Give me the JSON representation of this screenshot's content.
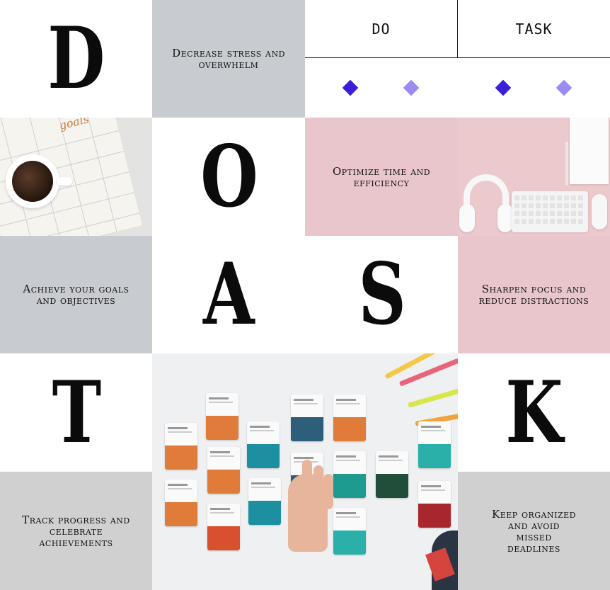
{
  "letters": {
    "d": "D",
    "o": "O",
    "a": "A",
    "s": "S",
    "t": "T",
    "k": "K"
  },
  "header": {
    "do": "DO",
    "task": "TASK"
  },
  "captions": {
    "stress": "Decrease stress and overwhelm",
    "optimize": "Optimize time and efficiency",
    "goals": "Achieve your goals and objectives",
    "focus": "Sharpen focus and reduce distractions",
    "progress": "Track progress and celebrate achievements",
    "organized": "Keep organized and avoid missed deadlines"
  },
  "photos": {
    "notebook_text": "goals"
  },
  "colors": {
    "gray": "#c8cbd0",
    "pink": "#e8c6cb",
    "diamond_dark": "#3a1fd9",
    "diamond_light": "#9a8cf2"
  }
}
